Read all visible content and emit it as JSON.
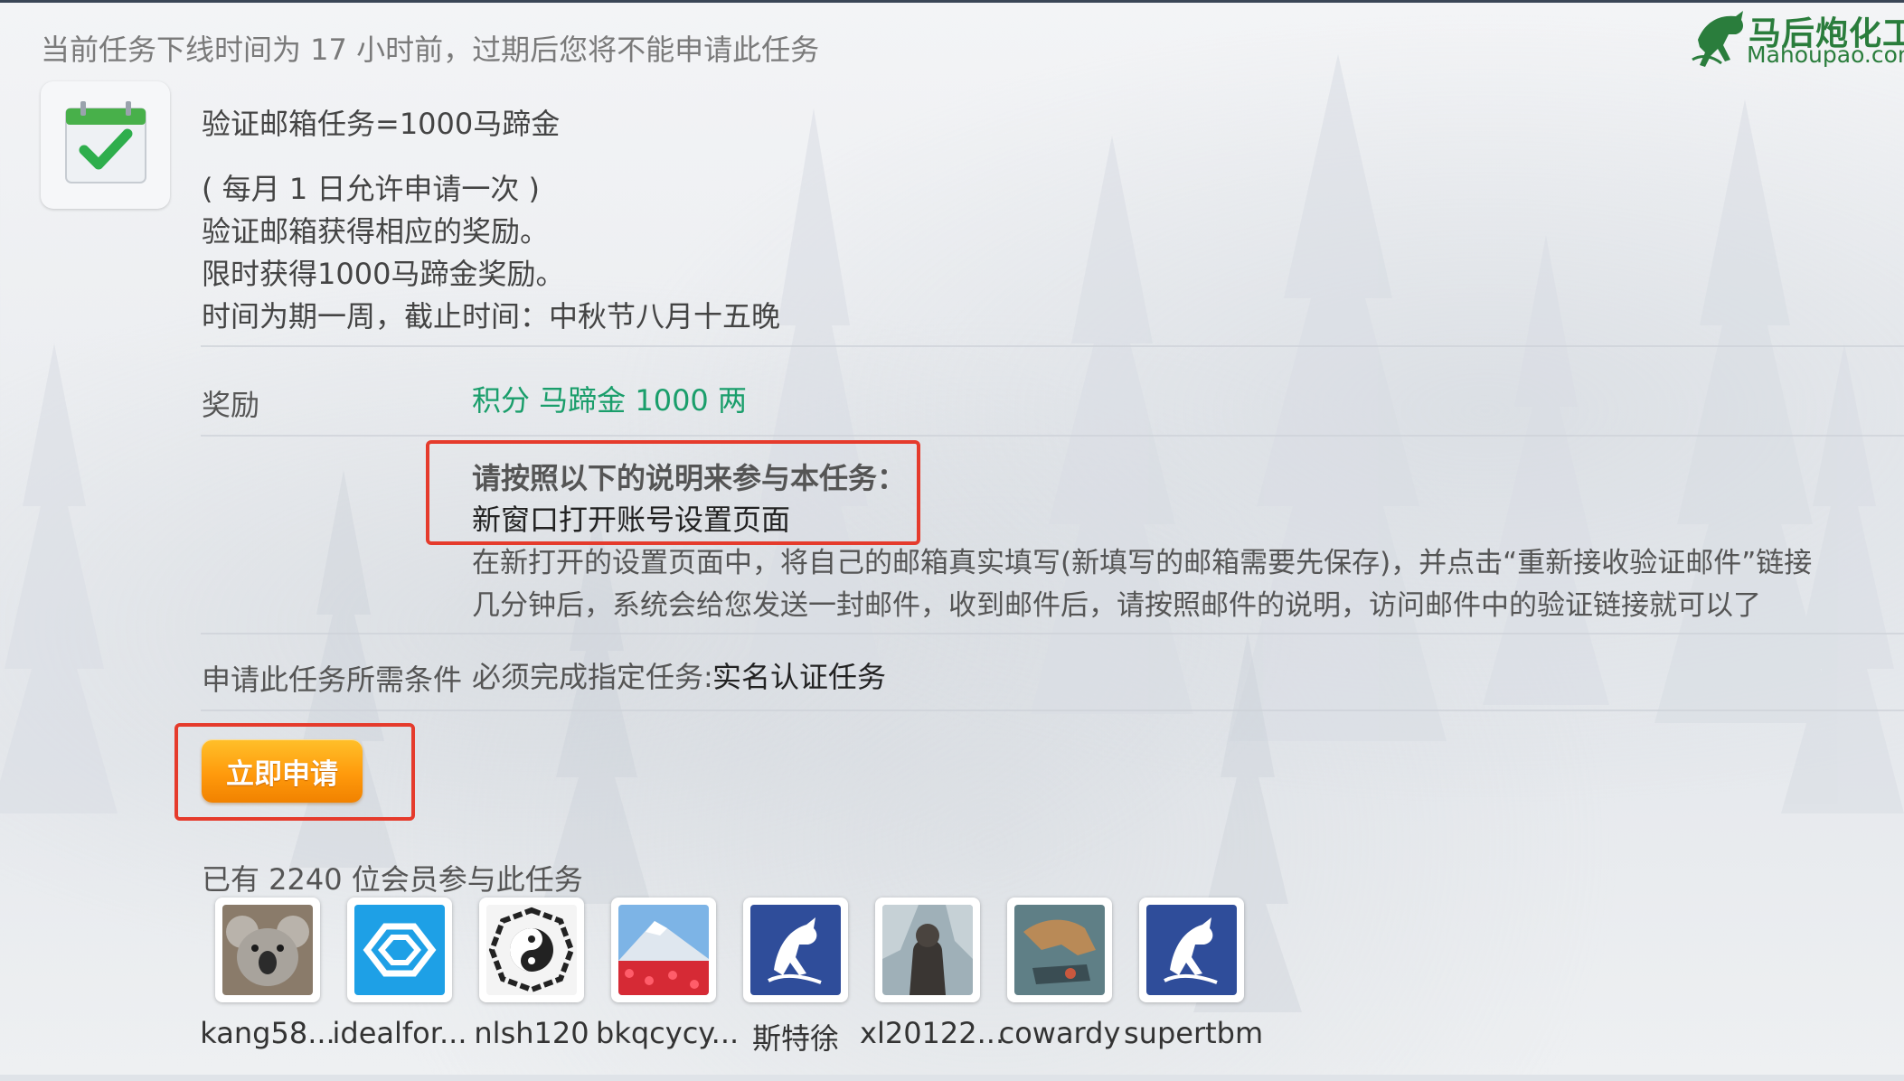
{
  "notice": "当前任务下线时间为 17 小时前，过期后您将不能申请此任务",
  "logo": {
    "cn": "马后炮化工",
    "en": "Mahoupao.com"
  },
  "task": {
    "title": "验证邮箱任务=1000马蹄金",
    "desc": [
      "( 每月 1 日允许申请一次 )",
      "验证邮箱获得相应的奖励。",
      "限时获得1000马蹄金奖励。",
      "时间为期一周，截止时间：中秋节八月十五晚"
    ]
  },
  "reward": {
    "label": "奖励",
    "value": "积分 马蹄金 1000 两"
  },
  "instructions": {
    "heading": "请按照以下的说明来参与本任务：",
    "link": "新窗口打开账号设置页面",
    "text": [
      "在新打开的设置页面中，将自己的邮箱真实填写(新填写的邮箱需要先保存)，并点击“重新接收验证邮件”链接",
      "几分钟后，系统会给您发送一封邮件，收到邮件后，请按照邮件的说明，访问邮件中的验证链接就可以了"
    ]
  },
  "requirement": {
    "label": "申请此任务所需条件",
    "prefix": "必须完成指定任务:",
    "task": "实名认证任务"
  },
  "apply_button": "立即申请",
  "members": {
    "count_text": "已有 2240 位会员参与此任务",
    "list": [
      {
        "name": "kang58...",
        "avatar": "koala-photo"
      },
      {
        "name": "idealfor...",
        "avatar": "blue-logo"
      },
      {
        "name": "nlsh120",
        "avatar": "bagua-symbol"
      },
      {
        "name": "bkqcycy...",
        "avatar": "mountain-flowers"
      },
      {
        "name": "斯特徐",
        "avatar": "horse-logo"
      },
      {
        "name": "xl20122...",
        "avatar": "armored-warrior"
      },
      {
        "name": "cowardy",
        "avatar": "tiger-art"
      },
      {
        "name": "supertbm",
        "avatar": "horse-logo"
      }
    ]
  },
  "colors": {
    "reward_green": "#1a9e6b",
    "highlight_red": "#e53b2c",
    "button_orange": "#ff9a0c",
    "logo_green": "#2a7d3c"
  }
}
